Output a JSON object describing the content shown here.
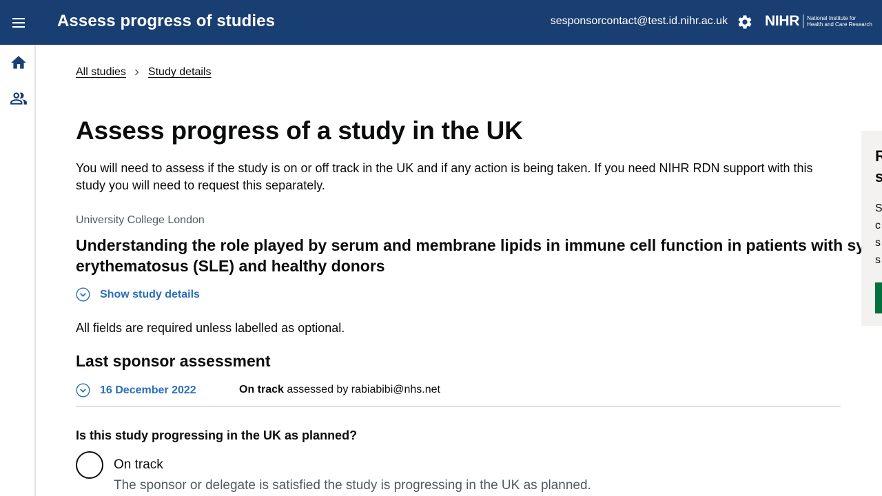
{
  "header": {
    "title": "Assess progress of studies",
    "user_email": "sesponsorcontact@test.id.nihr.ac.uk",
    "logo_mark": "NIHR",
    "logo_line1": "National Institute for",
    "logo_line2": "Health and Care Research",
    "background_color": "#193e72"
  },
  "sidenav": {
    "items": [
      {
        "icon": "home-icon"
      },
      {
        "icon": "people-icon"
      }
    ]
  },
  "breadcrumb": {
    "items": [
      "All studies",
      "Study details"
    ]
  },
  "page": {
    "title": "Assess progress of a study in the UK",
    "intro": "You will need to assess if the study is on or off track in the UK and if any action is being taken. If you need NIHR RDN support with this study you will need to request this separately."
  },
  "study": {
    "organisation": "University College London",
    "title_line1": "Understanding the role played by serum and membrane lipids in immune cell function in patients with syst",
    "title_line2": "erythematosus (SLE) and healthy donors",
    "show_details_label": "Show study details"
  },
  "form": {
    "required_note": "All fields are required unless labelled as optional.",
    "last_assessment_heading": "Last sponsor assessment",
    "last_assessment": {
      "date": "16 December 2022",
      "status": "On track",
      "assessed_by_text": "assessed by rabiabibi@nhs.net"
    },
    "question": "Is this study progressing in the UK as planned?",
    "options": [
      {
        "label": "On track",
        "hint": "The sponsor or delegate is satisfied the study is progressing in the UK as planned."
      }
    ]
  },
  "side_panel": {
    "title_line1": "R",
    "title_line2": "s",
    "body_lines": [
      "S",
      "c",
      "s",
      "s"
    ],
    "button_color": "#00703c"
  },
  "colors": {
    "link_blue": "#2a6fb8",
    "header_navy": "#193e72",
    "hint_grey": "#505a5f"
  }
}
